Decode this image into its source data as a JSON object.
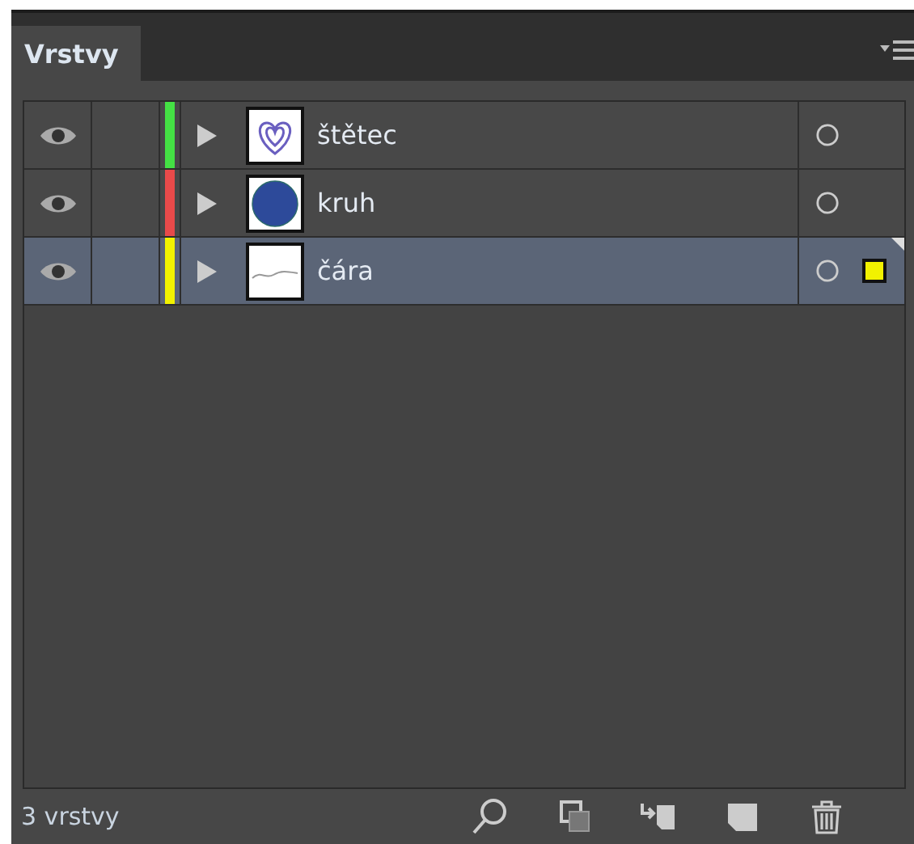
{
  "panel": {
    "tab": {
      "label": "Vrstvy",
      "selected": true
    }
  },
  "layers": [
    {
      "name": "štětec",
      "color": "#44e044",
      "visible": true,
      "selected": false,
      "thumbnail": {
        "kind": "heart"
      },
      "art_selected": false
    },
    {
      "name": "kruh",
      "color": "#e84a4a",
      "visible": true,
      "selected": false,
      "thumbnail": {
        "kind": "circle"
      },
      "art_selected": false
    },
    {
      "name": "čára",
      "color": "#f2f200",
      "visible": true,
      "selected": true,
      "thumbnail": {
        "kind": "line"
      },
      "art_selected": true
    }
  ],
  "status_bar": {
    "count": "3 vrstvy"
  }
}
